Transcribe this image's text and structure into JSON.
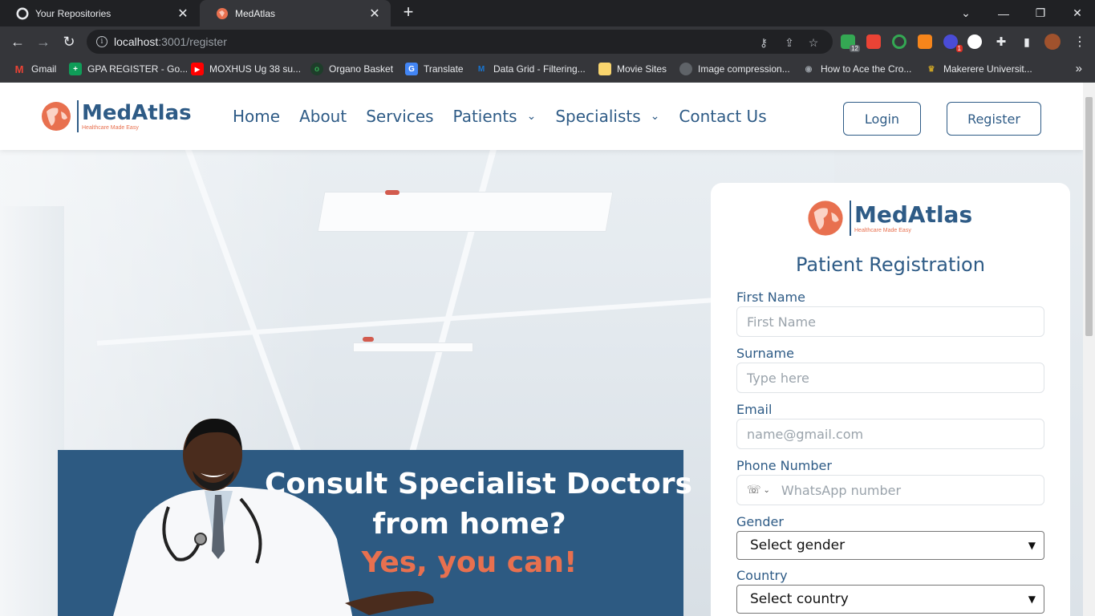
{
  "browser": {
    "tabs": [
      {
        "title": "Your Repositories",
        "active": false,
        "icon": "github-icon"
      },
      {
        "title": "MedAtlas",
        "active": true,
        "icon": "medatlas-favicon"
      }
    ],
    "url": {
      "host": "localhost",
      "path": ":3001/register"
    },
    "bookmarks": [
      {
        "label": "Gmail",
        "icon": "gmail-icon",
        "color": "#ea4335"
      },
      {
        "label": "GPA REGISTER - Go...",
        "icon": "sheets-icon",
        "color": "#0f9d58"
      },
      {
        "label": "MOXHUS Ug 38 su...",
        "icon": "youtube-icon",
        "color": "#ff0000"
      },
      {
        "label": "Organo Basket",
        "icon": "organo-icon",
        "color": "#34a853"
      },
      {
        "label": "Translate",
        "icon": "translate-icon",
        "color": "#4285f4"
      },
      {
        "label": "Data Grid - Filtering...",
        "icon": "mui-icon",
        "color": "#1976d2"
      },
      {
        "label": "Movie Sites",
        "icon": "folder-icon",
        "color": "#f9d56e"
      },
      {
        "label": "Image compression...",
        "icon": "github-icon",
        "color": "#5f6368"
      },
      {
        "label": "How to Ace the Cro...",
        "icon": "eye-icon",
        "color": "#5f6368"
      },
      {
        "label": "Makerere Universit...",
        "icon": "makerere-icon",
        "color": "#c9a227"
      }
    ],
    "extension_badges": {
      "ext1": "12",
      "ext2": "1"
    }
  },
  "site": {
    "brand": "MedAtlas",
    "tagline": "Healthcare Made Easy",
    "nav": [
      {
        "label": "Home"
      },
      {
        "label": "About"
      },
      {
        "label": "Services"
      },
      {
        "label": "Patients",
        "dropdown": true
      },
      {
        "label": "Specialists",
        "dropdown": true
      },
      {
        "label": "Contact Us"
      }
    ],
    "login_label": "Login",
    "register_label": "Register"
  },
  "hero": {
    "line1": "Consult Specialist Doctors",
    "line2": "from home?",
    "line3": "Yes, you can!"
  },
  "form": {
    "title": "Patient Registration",
    "first_name": {
      "label": "First Name",
      "placeholder": "First Name"
    },
    "surname": {
      "label": "Surname",
      "placeholder": "Type here"
    },
    "email": {
      "label": "Email",
      "placeholder": "name@gmail.com"
    },
    "phone": {
      "label": "Phone Number",
      "placeholder": "WhatsApp number"
    },
    "gender": {
      "label": "Gender",
      "value": "Select gender"
    },
    "country": {
      "label": "Country",
      "value": "Select country"
    }
  },
  "colors": {
    "brand_blue": "#2e5b86",
    "brand_orange": "#e8704f"
  }
}
